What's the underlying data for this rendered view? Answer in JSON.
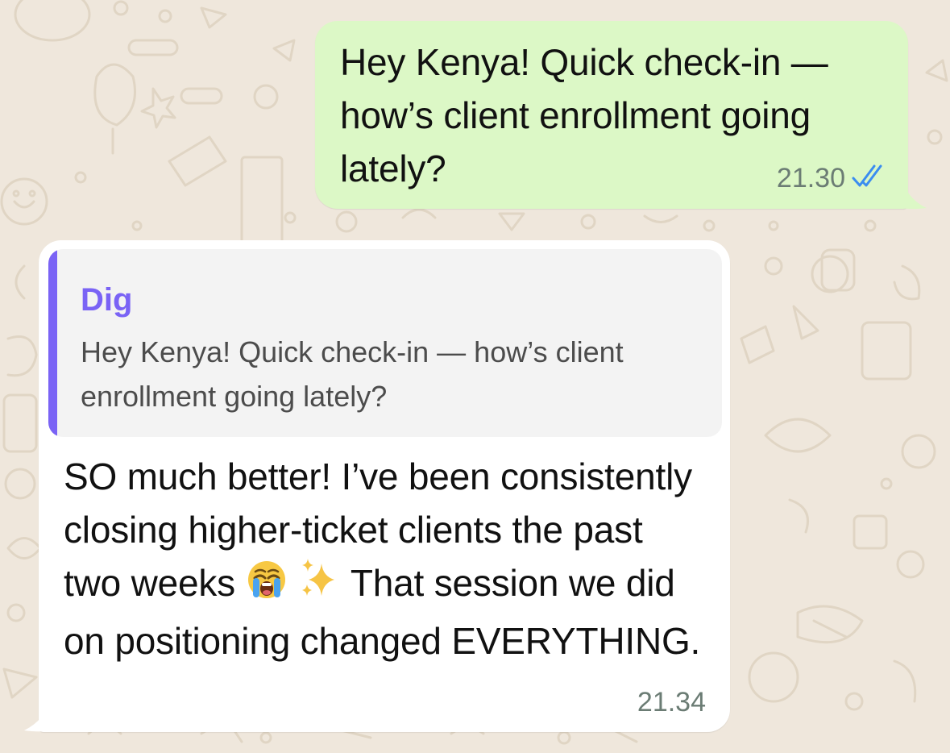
{
  "conversation": {
    "outgoing": {
      "text": "Hey Kenya! Quick check-in — how’s client enrollment going lately?",
      "time": "21.30",
      "status_icon": "double-check-icon",
      "bubble_color": "#dcf8c6",
      "check_color": "#3b8df0"
    },
    "incoming": {
      "reply_to": {
        "author": "Dig",
        "text": "Hey Kenya! Quick check-in — how’s client enrollment going lately?",
        "accent_color": "#7a63f5"
      },
      "text_part1": "SO much better! I’ve been consistently closing higher-ticket clients the past two weeks",
      "emoji_1": "loudly-crying-face-emoji",
      "emoji_2": "sparkles-emoji",
      "text_part2": "That session we did on positioning changed EVERYTHING.",
      "time": "21.34",
      "bubble_color": "#ffffff"
    }
  },
  "wallpaper": {
    "background_color": "#efe7dc",
    "doodle_color": "#e0d5c4"
  }
}
